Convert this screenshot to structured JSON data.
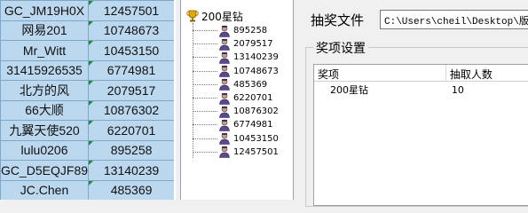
{
  "sheet": {
    "rows": [
      [
        "GC_JM19H0X",
        "12457501"
      ],
      [
        "网易201",
        "10748673"
      ],
      [
        "Mr_Witt",
        "10453150"
      ],
      [
        "31415926535",
        "6774981"
      ],
      [
        "北方的风",
        "2079517"
      ],
      [
        "66大顺",
        "10876302"
      ],
      [
        "九翼天使520",
        "6220701"
      ],
      [
        "lulu0206",
        "895258"
      ],
      [
        "GC_D5EQJF89",
        "13140239"
      ],
      [
        "JC.Chen",
        "485369"
      ]
    ]
  },
  "tree": {
    "root_label": "200星钻",
    "root_icon": "trophy-icon",
    "node_icon": "user-icon",
    "nodes": [
      "895258",
      "2079517",
      "13140239",
      "10748673",
      "485369",
      "6220701",
      "10876302",
      "6774981",
      "10453150",
      "12457501"
    ]
  },
  "settings": {
    "file_label": "抽奖文件",
    "file_path": "C:\\Users\\cheil\\Desktop\\版块",
    "group_title": "奖项设置",
    "columns": [
      "奖项",
      "抽取人数"
    ],
    "rows": [
      {
        "prize": "200星钻",
        "count": "10"
      }
    ]
  },
  "colors": {
    "cell_bg": "#bcd8ef",
    "cell_border": "#7fa7c9",
    "comment_marker": "#1a8a3a"
  }
}
